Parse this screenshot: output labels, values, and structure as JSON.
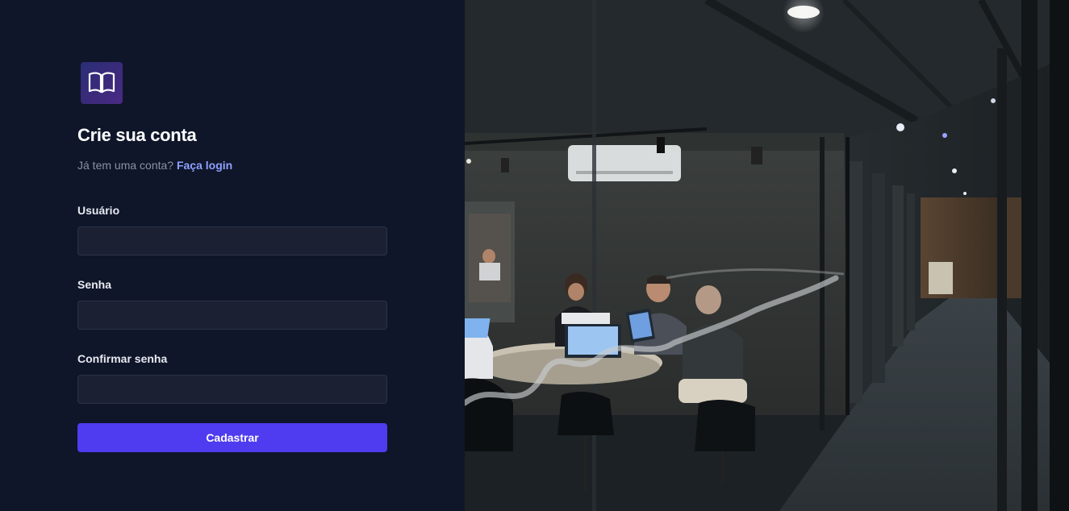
{
  "signup": {
    "title": "Crie sua conta",
    "subtitle_prefix": "Já tem uma conta?",
    "login_link": "Faça login",
    "username_label": "Usuário",
    "password_label": "Senha",
    "confirm_label": "Confirmar senha",
    "submit_label": "Cadastrar"
  },
  "icons": {
    "logo": "open-book-icon"
  },
  "colors": {
    "background": "#0f1629",
    "input_bg": "#1b2133",
    "accent": "#4f3bf0",
    "link": "#8fa0ff"
  }
}
